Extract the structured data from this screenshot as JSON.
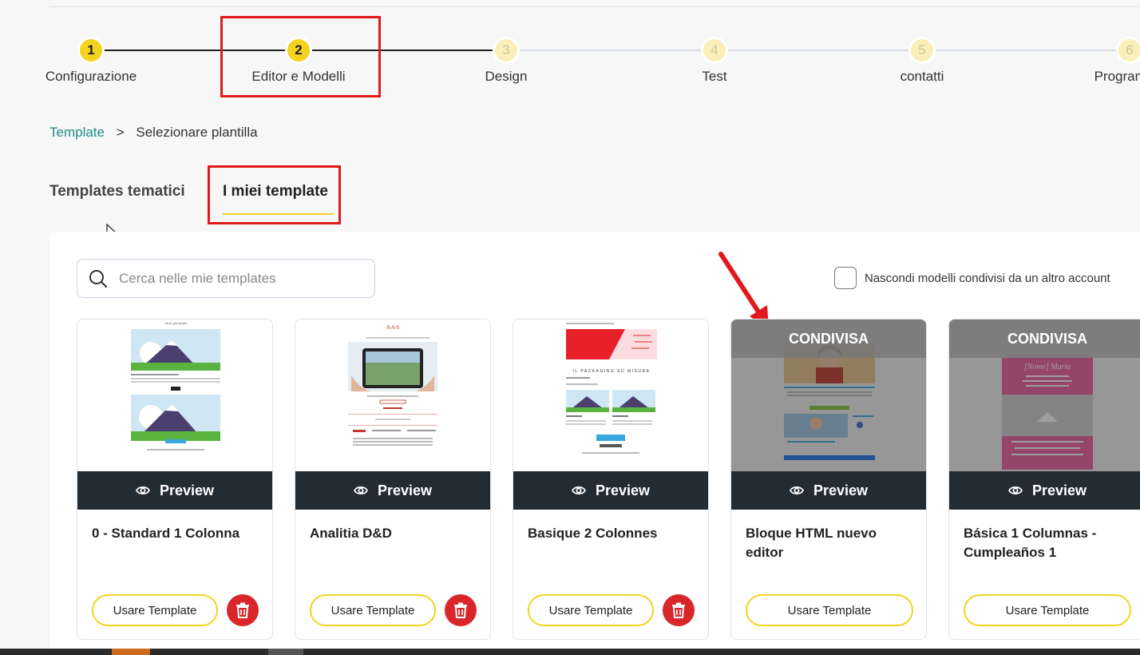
{
  "stepper": {
    "steps": [
      {
        "number": "1",
        "label": "Configurazione"
      },
      {
        "number": "2",
        "label": "Editor e Modelli"
      },
      {
        "number": "3",
        "label": "Design"
      },
      {
        "number": "4",
        "label": "Test"
      },
      {
        "number": "5",
        "label": "contatti"
      },
      {
        "number": "6",
        "label": "Programma"
      }
    ],
    "current_step": 2
  },
  "breadcrumb": {
    "link": "Template",
    "separator": ">",
    "current": "Selezionare plantilla"
  },
  "tabs": [
    {
      "label": "Templates tematici",
      "active": false
    },
    {
      "label": "I miei template",
      "active": true
    }
  ],
  "search": {
    "placeholder": "Cerca nelle mie templates"
  },
  "hide_shared": {
    "label": "Nascondi modelli condivisi da un altro account",
    "checked": false
  },
  "cards": [
    {
      "title": "0 - Standard 1 Colonna",
      "preview_label": "Preview",
      "use_label": "Usare Template",
      "shared": false
    },
    {
      "title": "Analitia D&D",
      "preview_label": "Preview",
      "use_label": "Usare Template",
      "shared": false
    },
    {
      "title": "Basique 2 Colonnes",
      "preview_label": "Preview",
      "use_label": "Usare Template",
      "shared": false
    },
    {
      "title": "Bloque HTML nuevo editor",
      "preview_label": "Preview",
      "use_label": "Usare Template",
      "shared": true,
      "shared_label": "CONDIVISA"
    },
    {
      "title": "Básica 1 Columnas - Cumpleaños 1",
      "preview_label": "Preview",
      "use_label": "Usare Template",
      "shared": true,
      "shared_label": "CONDIVISA"
    }
  ],
  "thumb_texts": {
    "card1_header": "Titolo principale",
    "card5_name": "[Nome] Maria",
    "card3_heading": "IL PACKAGING SU MISURA"
  },
  "colors": {
    "accent_yellow": "#f4d31f",
    "teal_link": "#1d8c88",
    "dark_bar": "#232b33",
    "delete_red": "#d9262b",
    "highlight_red": "#e01a1a"
  }
}
